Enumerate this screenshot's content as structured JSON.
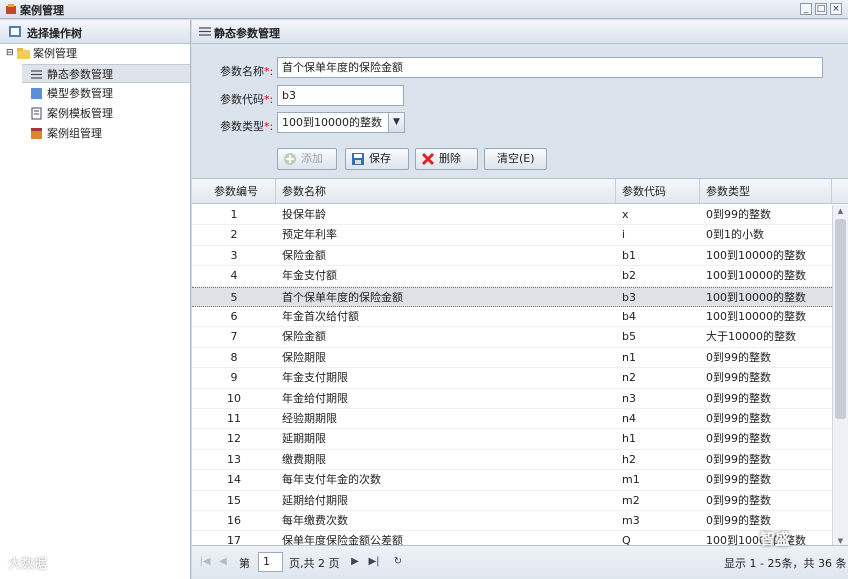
{
  "window": {
    "title": "案例管理"
  },
  "left_panel": {
    "title": "选择操作树",
    "tree": [
      {
        "label": "案例管理",
        "icon": "folder-icon"
      },
      {
        "label": "静态参数管理",
        "icon": "list-icon",
        "selected": true
      },
      {
        "label": "模型参数管理",
        "icon": "box-icon"
      },
      {
        "label": "案例模板管理",
        "icon": "document-icon"
      },
      {
        "label": "案例组管理",
        "icon": "package-icon"
      }
    ]
  },
  "main_panel": {
    "title": "静态参数管理"
  },
  "form": {
    "name_label": "参数名称",
    "name_value": "首个保单年度的保险金额",
    "code_label": "参数代码",
    "code_value": "b3",
    "type_label": "参数类型",
    "type_value": "100到10000的整数",
    "required_mark": "*:",
    "buttons": {
      "add": "添加",
      "save": "保存",
      "delete": "删除",
      "clear": "清空(E)"
    }
  },
  "grid": {
    "columns": [
      "参数编号",
      "参数名称",
      "参数代码",
      "参数类型"
    ],
    "rows": [
      [
        "1",
        "投保年龄",
        "x",
        "0到99的整数"
      ],
      [
        "2",
        "预定年利率",
        "i",
        "0到1的小数"
      ],
      [
        "3",
        "保险金额",
        "b1",
        "100到10000的整数"
      ],
      [
        "4",
        "年金支付额",
        "b2",
        "100到10000的整数"
      ],
      [
        "5",
        "首个保单年度的保险金额",
        "b3",
        "100到10000的整数"
      ],
      [
        "6",
        "年金首次给付额",
        "b4",
        "100到10000的整数"
      ],
      [
        "7",
        "保险金额",
        "b5",
        "大于10000的整数"
      ],
      [
        "8",
        "保险期限",
        "n1",
        "0到99的整数"
      ],
      [
        "9",
        "年金支付期限",
        "n2",
        "0到99的整数"
      ],
      [
        "10",
        "年金给付期限",
        "n3",
        "0到99的整数"
      ],
      [
        "11",
        "经验期期限",
        "n4",
        "0到99的整数"
      ],
      [
        "12",
        "延期期限",
        "h1",
        "0到99的整数"
      ],
      [
        "13",
        "缴费期限",
        "h2",
        "0到99的整数"
      ],
      [
        "14",
        "每年支付年金的次数",
        "m1",
        "0到99的整数"
      ],
      [
        "15",
        "延期给付期限",
        "m2",
        "0到99的整数"
      ],
      [
        "16",
        "每年缴费次数",
        "m3",
        "0到99的整数"
      ],
      [
        "17",
        "保单年度保险金额公差额",
        "Q",
        "100到10000的整数"
      ]
    ],
    "selected_row": 4
  },
  "pager": {
    "page_prefix": "第",
    "page_value": "1",
    "page_suffix": "页,共 2 页",
    "summary": "显示 1 - 25条，共 36 条"
  },
  "watermarks": {
    "left": "大数据",
    "right": "智盛"
  },
  "colors": {
    "selected_row": "#dfe1e6",
    "required": "#dd0000",
    "header_bg": "#dbe3ed"
  }
}
